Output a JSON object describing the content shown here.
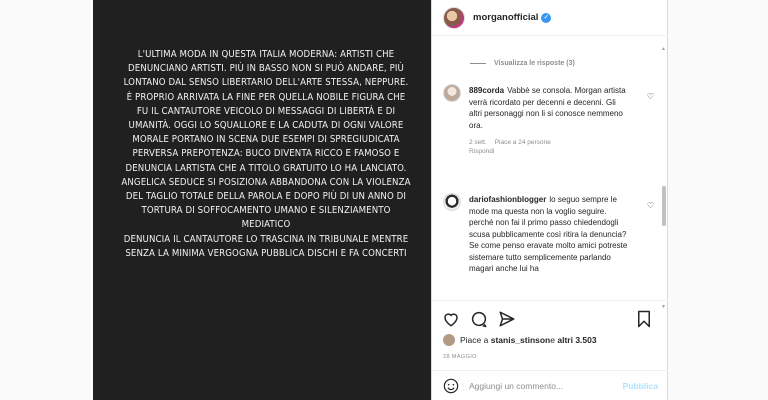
{
  "header": {
    "username": "morganofficial",
    "verified_glyph": "✓"
  },
  "story": {
    "text": "L'ULTIMA MODA IN QUESTA ITALIA MODERNA: ARTISTI CHE DENUNCIANO ARTISTI. PIÙ IN BASSO NON SI PUÒ ANDARE, PIÙ LONTANO DAL SENSO LIBERTARIO DELL'ARTE STESSA, NEPPURE. È PROPRIO ARRIVATA LA FINE PER QUELLA NOBILE FIGURA CHE FU IL CANTAUTORE VEICOLO DI MESSAGGI DI LIBERTÀ E DI UMANITÀ. OGGI LO SQUALLORE E LA CADUTA DI OGNI VALORE MORALE PORTANO IN SCENA DUE ESEMPI DI SPREGIUDICATA PERVERSA PREPOTENZA: BUCO DIVENTA RICCO E FAMOSO E DENUNCIA LARTISTA CHE A TITOLO GRATUITO LO HA LANCIATO.\nANGELICA SEDUCE SI POSIZIONA ABBANDONA CON LA VIOLENZA DEL TAGLIO TOTALE DELLA PAROLA E DOPO PIÙ DI UN ANNO  DI TORTURA DI SOFFOCAMENTO UMANO E SILENZIAMENTO MEDIATICO\nDENUNCIA IL CANTAUTORE LO TRASCINA IN TRIBUNALE MENTRE SENZA LA MINIMA VERGOGNA PUBBLICA DISCHI  E FA CONCERTI"
  },
  "comments": {
    "view_replies": "Visualizza le risposte (3)",
    "items": [
      {
        "user": "889corda",
        "text": "Vabbè se consola. Morgan artista verrà ricordato per decenni e decenni. Gli altri personaggi non li si conosce nemmeno ora.",
        "time": "2 sett.",
        "likes": "Piace a 24 persone",
        "reply": "Rispondi"
      },
      {
        "user": "dariofashionblogger",
        "text": "lo seguo sempre le mode ma questa non la voglio seguire. perché non fai il primo passo chiedendogli scusa pubblicamente così ritira la denuncia? Se come penso eravate molto amici potreste sistemare tutto semplicemente parlando magari anche lui ha"
      }
    ]
  },
  "likes_line": {
    "prefix": "Piace a ",
    "user": "stanis_stinson",
    "middle": " e ",
    "others": "altri 3.503"
  },
  "date": "28 MAGGIO",
  "add_comment": {
    "placeholder": "Aggiungi un commento...",
    "publish": "Pubblica"
  },
  "icons": [
    "heart-icon",
    "comment-icon",
    "share-icon",
    "bookmark-icon",
    "emoji-icon",
    "verified-icon"
  ]
}
